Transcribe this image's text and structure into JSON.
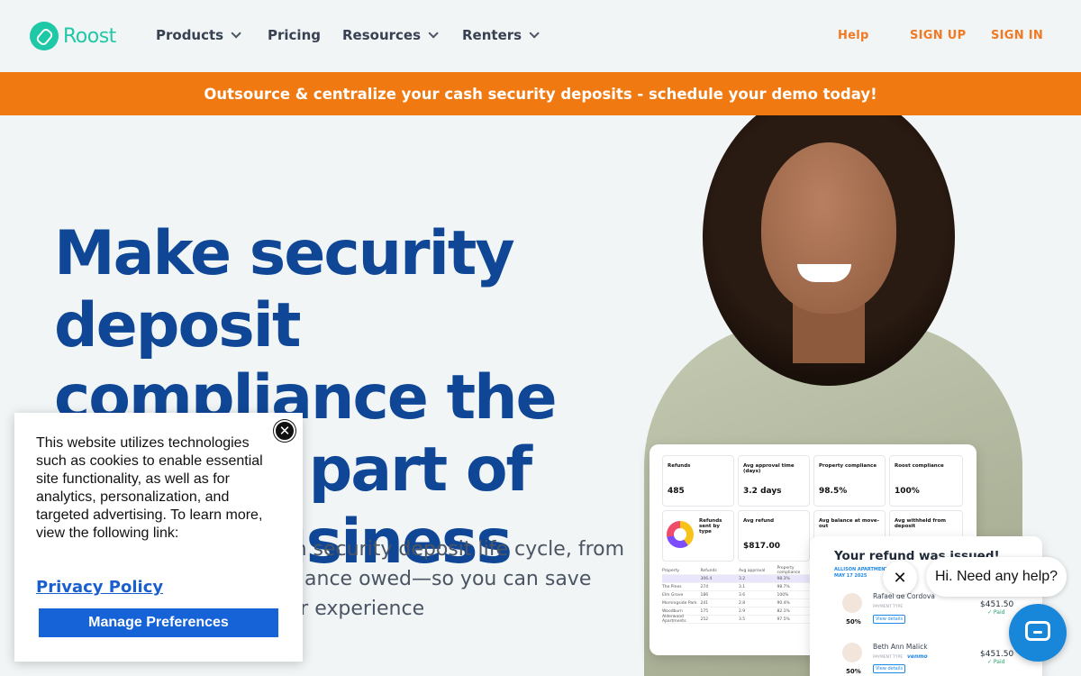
{
  "nav": {
    "logo": "Roost",
    "items": [
      {
        "label": "Products"
      },
      {
        "label": "Pricing"
      },
      {
        "label": "Resources"
      },
      {
        "label": "Renters"
      }
    ],
    "help": "Help",
    "signup": "SIGN UP",
    "signin": "SIGN IN"
  },
  "banner": "Outsource & centralize your cash security deposits - schedule your demo today!",
  "hero": {
    "title": "Make security deposit compliance the easiest part of your business",
    "subtitle": "Automate the entire cash security deposit life cycle, from collection & refund to balance owed—so you can save time, and deliver a better experience"
  },
  "dashboard": {
    "tiles": [
      {
        "label": "Refunds",
        "value": "485"
      },
      {
        "label": "Avg approval time (days)",
        "value": "3.2 days"
      },
      {
        "label": "Property compliance",
        "value": "98.5%"
      },
      {
        "label": "Roost compliance",
        "value": "100%"
      },
      {
        "label": "Refunds sent by type",
        "value": ""
      },
      {
        "label": "Avg refund",
        "value": "$817.00"
      },
      {
        "label": "Avg balance at move-out",
        "value": ""
      },
      {
        "label": "Avg withheld from deposit",
        "value": ""
      }
    ],
    "table_rows": [
      [
        "Property",
        "Refunds",
        "Avg approval",
        "Property compliance"
      ],
      [
        "",
        "306.4",
        "3.2",
        "98.3%"
      ],
      [
        "The Pines",
        "274",
        "3.1",
        "98.7%"
      ],
      [
        "Elm Grove",
        "186",
        "3.6",
        "100%"
      ],
      [
        "Morningside Park",
        "241",
        "2.8",
        "90.4%"
      ],
      [
        "Woodburn",
        "175",
        "2.9",
        "82.1%"
      ],
      [
        "Alderwood Apartments",
        "252",
        "3.5",
        "97.5%"
      ]
    ]
  },
  "refund": {
    "title": "Your refund was issued!",
    "subtitle": "ALLISON APARTMENTS | UP",
    "date": "MAY 17 2025",
    "people": [
      {
        "name": "Rafael de Cordova",
        "type": "PAYMENT TYPE",
        "amount": "$451.50",
        "status": "✓ Paid",
        "pct": "50%",
        "button": "View details"
      },
      {
        "name": "Beth Ann Malick",
        "type": "PAYMENT TYPE",
        "amount": "$451.50",
        "status": "✓ Paid",
        "pct": "50%",
        "button": "View details"
      }
    ],
    "venmo": "venmo"
  },
  "cookie": {
    "text": "This website utilizes technologies such as cookies to enable essential site functionality, as well as for analytics, personalization, and targeted advertising. To learn more, view the following link:",
    "link": "Privacy Policy",
    "button": "Manage Preferences",
    "close": "✕"
  },
  "chat": {
    "greeting": "Hi. Need any help?",
    "close": "✕"
  },
  "colors": {
    "brand": "#1fc8a6",
    "accent": "#f07a11",
    "title": "#0f4796",
    "chat": "#1987d9",
    "cookie_button": "#1563d6"
  }
}
